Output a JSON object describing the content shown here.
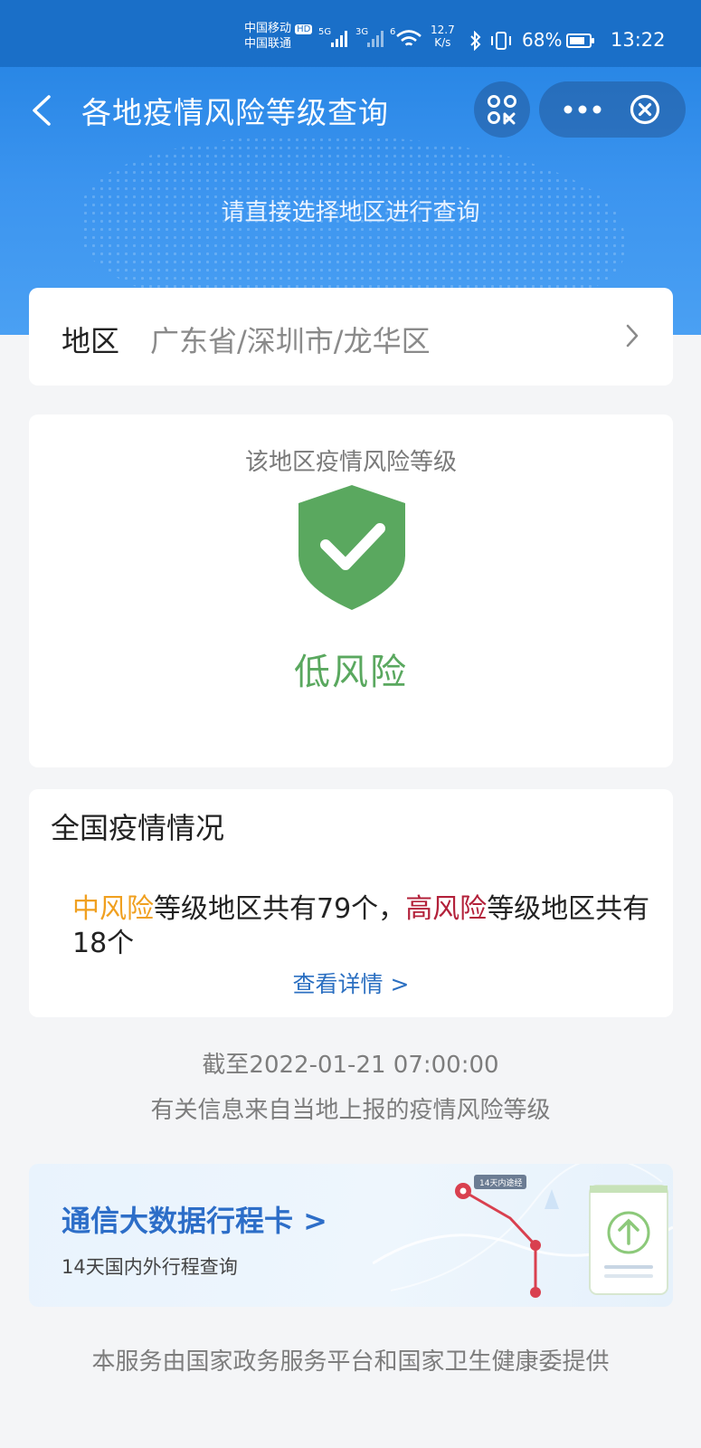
{
  "status_bar": {
    "carrier_1": "中国移动",
    "carrier_hd": "HD",
    "carrier_2": "中国联通",
    "sig_5g": "5G",
    "sig_3g": "3G",
    "sig_wifi": "6",
    "speed_value": "12.7",
    "speed_unit": "K/s",
    "battery": "68%",
    "time": "13:22"
  },
  "header": {
    "title": "各地疫情风险等级查询",
    "subtitle": "请直接选择地区进行查询"
  },
  "region": {
    "label": "地区",
    "value": "广东省/深圳市/龙华区"
  },
  "risk": {
    "caption": "该地区疫情风险等级",
    "level": "低风险",
    "color": "#5aa85f"
  },
  "national": {
    "title": "全国疫情情况",
    "medium_label": "中风险",
    "medium_text": "等级地区共有79个，",
    "high_label": "高风险",
    "high_text": "等级地区共有18个",
    "detail_link": "查看详情 >"
  },
  "timestamp": "截至2022-01-21 07:00:00",
  "source_note": "有关信息来自当地上报的疫情风险等级",
  "itinerary": {
    "title": "通信大数据行程卡 >",
    "subtitle": "14天国内外行程查询",
    "map_tag": "14天内途经"
  },
  "footer": "本服务由国家政务服务平台和国家卫生健康委提供",
  "colors": {
    "header_blue": "#1f7fe0",
    "link_blue": "#2b6fc1",
    "medium_risk": "#f0a020",
    "high_risk": "#b3213a"
  }
}
